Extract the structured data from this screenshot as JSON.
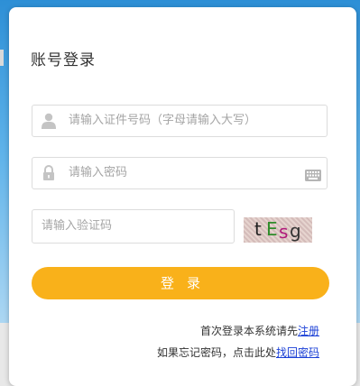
{
  "login": {
    "title": "账号登录",
    "id_placeholder": "请输入证件号码（字母请输入大写）",
    "password_placeholder": "请输入密码",
    "captcha_placeholder": "请输入验证码",
    "captcha_chars": [
      "t",
      "E",
      "s",
      "g"
    ],
    "captcha_colors": [
      "#222222",
      "#2f8c2a",
      "#b0187a",
      "#333333"
    ],
    "login_button": "登录",
    "first_login_text": "首次登录本系统请先",
    "register_link": "注册",
    "forgot_text": "如果忘记密码，点击此处",
    "forgot_link": "找回密码"
  },
  "colors": {
    "accent": "#f9b11a",
    "link": "#1a3fd6",
    "placeholder": "#a5a5a5"
  },
  "icons": {
    "user_field": "user-icon",
    "password_field": "lock-icon",
    "keyboard": "keyboard-icon"
  }
}
